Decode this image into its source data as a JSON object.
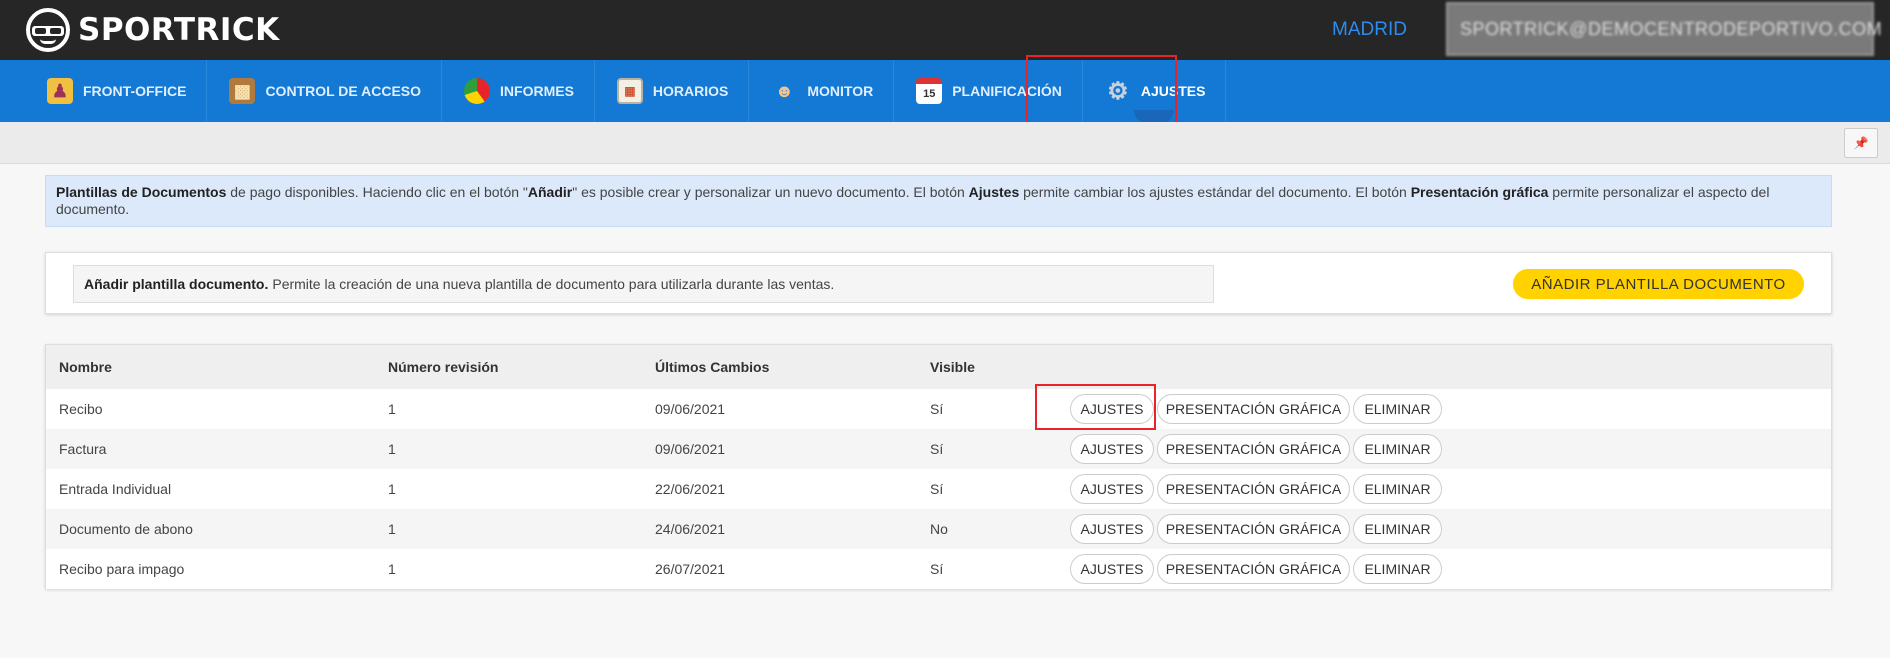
{
  "header": {
    "brand": "SPORTRICK",
    "location": "MADRID",
    "user": "SPORTRICK@DEMOCENTRODEPORTIVO.COM"
  },
  "nav": [
    {
      "label": "FRONT-OFFICE",
      "icon": "front-office-icon"
    },
    {
      "label": "CONTROL DE ACCESO",
      "icon": "door-icon"
    },
    {
      "label": "INFORMES",
      "icon": "pie-chart-icon"
    },
    {
      "label": "HORARIOS",
      "icon": "calendar-grid-icon"
    },
    {
      "label": "MONITOR",
      "icon": "people-icon"
    },
    {
      "label": "PLANIFICACIÓN",
      "icon": "calendar-icon"
    },
    {
      "label": "AJUSTES",
      "icon": "gear-icon",
      "active": true
    }
  ],
  "info": {
    "p1": "Plantillas de Documentos",
    "p2": " de pago disponibles. Haciendo clic en el botón \"",
    "p3": "Añadir",
    "p4": "\" es posible crear y personalizar un nuevo documento. El botón ",
    "p5": "Ajustes",
    "p6": " permite cambiar los ajustes estándar del documento. El botón ",
    "p7": "Presentación gráfica",
    "p8": " permite personalizar el aspecto del documento."
  },
  "add_panel": {
    "title": "Añadir plantilla documento.",
    "desc": "Permite la creación de una nueva plantilla de documento para utilizarla durante las ventas.",
    "button": "AÑADIR PLANTILLA DOCUMENTO"
  },
  "table": {
    "headers": [
      "Nombre",
      "Número revisión",
      "Últimos Cambios",
      "Visible"
    ],
    "rows": [
      {
        "name": "Recibo",
        "rev": "1",
        "date": "09/06/2021",
        "visible": "Sí"
      },
      {
        "name": "Factura",
        "rev": "1",
        "date": "09/06/2021",
        "visible": "Sí"
      },
      {
        "name": "Entrada Individual",
        "rev": "1",
        "date": "22/06/2021",
        "visible": "Sí"
      },
      {
        "name": "Documento de abono",
        "rev": "1",
        "date": "24/06/2021",
        "visible": "No"
      },
      {
        "name": "Recibo para impago",
        "rev": "1",
        "date": "26/07/2021",
        "visible": "Sí"
      }
    ],
    "actions": {
      "settings": "AJUSTES",
      "graphic": "PRESENTACIÓN GRÁFICA",
      "delete": "ELIMINAR"
    }
  },
  "colors": {
    "topbar": "#262626",
    "nav": "#1479d4",
    "accent": "#ffd200",
    "highlight": "#e8242b",
    "location": "#2d8cf0"
  }
}
